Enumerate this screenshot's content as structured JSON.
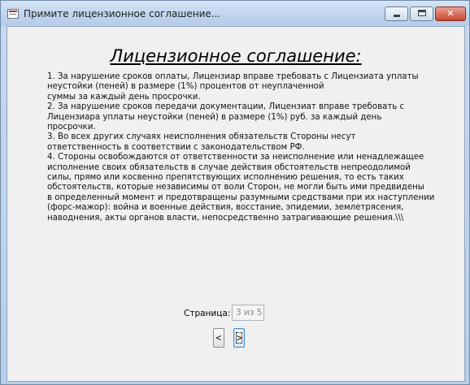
{
  "window": {
    "title": "Примите лицензионное соглашение...",
    "icon": "app-icon",
    "controls": {
      "minimize": "minimize-icon",
      "maximize": "maximize-icon",
      "close_label": "✕"
    }
  },
  "content": {
    "heading": "Лицензионное соглашение:",
    "paragraph_lines": [
      "1. За нарушение сроков оплаты, Лицензиар вправе требовать с Лицензиата уплаты",
      "неустойки (пеней) в размере (1%) процентов от неуплаченной",
      "суммы за каждый день просрочки.",
      "2. За нарушение сроков передачи документации, Лицензиат вправе требовать с",
      "Лицензиара уплаты неустойки (пеней) в размере (1%) руб. за каждый день",
      "просрочки.",
      "3. Во всех других случаях неисполнения обязательств Стороны несут",
      "ответственность в соответствии с законодательством РФ.",
      "4. Стороны освобождаются от ответственности за неисполнение или ненадлежащее",
      "исполнение своих обязательств в случае действия обстоятельств непреодолимой",
      "силы, прямо или косвенно препятствующих исполнению решения, то есть таких",
      "обстоятельств, которые независимы от воли Сторон, не могли быть ими предвидены",
      "в определенный момент и предотвращены разумными средствами при их наступлении",
      "(форс-мажор): война и военные действия, восстание, эпидемии, землетрясения,",
      "наводнения, акты органов власти, непосредственно затрагивающие решения.\\\\\\"
    ]
  },
  "pager": {
    "label": "Страница:",
    "value": "3 из 5",
    "prev_label": "<",
    "next_label": ">"
  }
}
